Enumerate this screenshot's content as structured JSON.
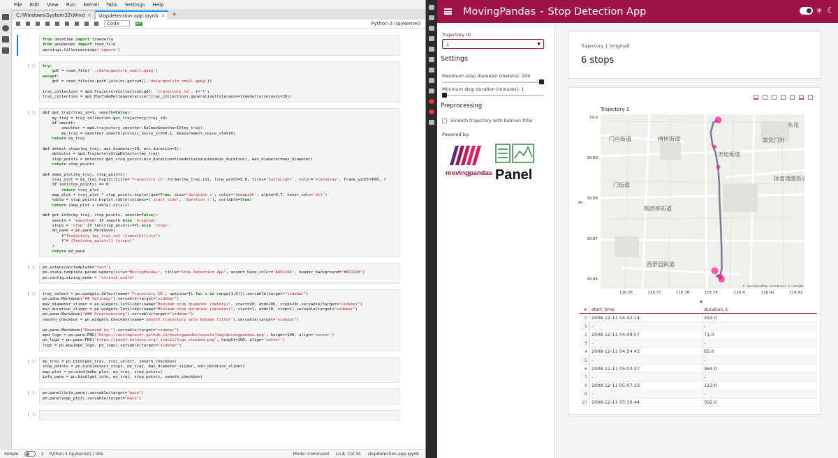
{
  "jupyter": {
    "menu": [
      "File",
      "Edit",
      "View",
      "Run",
      "Kernel",
      "Tabs",
      "Settings",
      "Help"
    ],
    "tabs": [
      {
        "label": "C:\\Windows\\System32\\Wind"
      },
      {
        "label": "stopdetection-app.ipynb"
      }
    ],
    "toolbar": {
      "cell_type": "Code",
      "kernel": "Python 3 (ipykernel)"
    },
    "cells": [
      {
        "prompt": "",
        "lines": [
          "from datetime import timedelta",
          "from geopandas import read_file",
          "warnings.filterwarnings('ignore')"
        ]
      },
      {
        "prompt": "[ ]:",
        "lines": [
          "try:",
          "    gdf = read_file('../data/geolife_small.gpkg')",
          "except:",
          "    gdf = read_file(os.path.join(os.getcwd(),'data/geolife_small.gpkg'))",
          "",
          "traj_collection = mpd.TrajectoryCollection(gdf, 'trajectory_id', t='t')",
          "traj_collection = mpd.MinTimeDeltaGeneralizer(traj_collection).generalize(tolerance=timedelta(seconds=30))"
        ]
      },
      {
        "prompt": "[ ]:",
        "lines": [
          "def get_traj(traj_id=1, smooth=False):",
          "    my_traj = traj_collection.get_trajectory(traj_id)",
          "    if smooth:",
          "        smoother = mpd.trajectory_smoother.KalmanSmootherCV(my_traj)",
          "        my_traj = smoother.smooth(process_noise_std=0.1, measurement_noise_std=10)",
          "    return my_traj",
          "",
          "def detect_stops(my_traj, max_diameter=10, min_duration=1):",
          "    detector = mpd.TrajectoryStopDetector(my_traj)",
          "    stop_points = detector.get_stop_points(min_duration=timedelta(minutes=min_duration), max_diameter=max_diameter)",
          "    return stop_points",
          "",
          "def make_plot(my_traj, stop_points):",
          "    traj_plot = my_traj.hvplot(title='Trajectory {}'.format(my_traj.id), line_width=5.0, tiles='CartoLight', color='slategray', frame_width=600, f",
          "    if len(stop_points) == 0:",
          "        return traj_plot",
          "    map_plot = traj_plot * stop_points.hvplot(geo=True, size='duration_s', color='deeppink', alpha=0.7, hover_cols='all')",
          "    table = stop_points.hvplot.table(columns=['start_time', 'duration_s'], sortable=True)",
          "    return (map_plot + table).cols(1)",
          "",
          "def get_info(my_traj, stop_points, smooth=False):",
          "    smooth = 'smoothed' if smooth else 'original'",
          "    stops = 'stop' if len(stop_points)==1 else 'stops'",
          "    md_pane = pn.pane.Markdown(",
          "        f\"Trajectory {my_traj.id} ({smooth})\\n\\n\"+",
          "        f\"# {len(stop_points)} {stops}\"",
          "    )",
          "    return md_pane"
        ]
      },
      {
        "prompt": "[ ]:",
        "lines": [
          "pn.extension(template=\"fast\")",
          "pn.state.template.param.update(site=\"MovingPandas\", title=\"Stop Detection App\", accent_base_color=\"#A01346\", header_background=\"#A01346\")",
          "pn.config.sizing_mode = \"stretch_width\""
        ]
      },
      {
        "prompt": "[ ]:",
        "lines": [
          "traj_select = pn.widgets.Select(name='Trajectory ID', options=[i for i in range(1,6)]).servable(target=\"sidebar\")",
          "pn.pane.Markdown(\"## Settings\").servable(target=\"sidebar\")",
          "max_diameter_slider = pn.widgets.IntSlider(name=\"Maximum stop diameter (meters)\", start=20, end=200, step=20).servable(target=\"sidebar\")",
          "min_duration_slider = pn.widgets.IntSlider(name=\"Minimum stop duration (minutes)\", start=1, end=10, step=1).servable(target=\"sidebar\")",
          "pn.pane.Markdown(\"### Preprocessing\").servable(target=\"sidebar\")",
          "smooth_checkbox = pn.widgets.Checkbox(name='Smooth trajectory with Kalman filter').servable(target=\"sidebar\")",
          "",
          "pn.pane.Markdown(\"Powered by:\").servable(target=\"sidebar\")",
          "mpd_logo = pn.pane.PNG('https://anitagraser.github.io/movingpandas/assets/img/movingpandas.png', height=100, align='center')",
          "pn_logo = pn.pane.PNG('https://panel.holoviz.org/_static/logo_stacked.png', height=100, align='center')",
          "logo = pn.Row(mpd_logo, pn_logo).servable(target=\"sidebar\")"
        ]
      },
      {
        "prompt": "[ ]:",
        "lines": [
          "my_traj = pn.bind(get_traj, traj_select, smooth_checkbox)",
          "stop_points = pn.bind(detect_stops, my_traj, max_diameter_slider, min_duration_slider)",
          "map_plot = pn.bind(make_plot, my_traj, stop_points)",
          "info_pane = pn.bind(get_info, my_traj, stop_points, smooth_checkbox)"
        ]
      },
      {
        "prompt": "[ ]:",
        "lines": [
          "pn.panel(info_pane).servable(target=\"main\")",
          "pn.panel(map_plot).servable(target=\"main\")"
        ]
      },
      {
        "prompt": "[ ]:",
        "lines": [
          ""
        ]
      }
    ],
    "status": {
      "mode_label": "Simple",
      "cursor_info": "1",
      "kernel_status": "Python 3 (ipykernel) | Idle",
      "mode": "Mode: Command",
      "position": "Ln 8, Col 34",
      "filename": "stopdetection-app.ipynb"
    }
  },
  "app": {
    "site": "MovingPandas",
    "title": "Stop Detection App",
    "header_color": "#a01346",
    "sidebar": {
      "traj_label": "Trajectory ID",
      "traj_value": "1",
      "settings_heading": "Settings",
      "max_diameter_label": "Maximum stop diameter (meters):",
      "max_diameter_value": "200",
      "max_diameter_fraction": 1.0,
      "min_duration_label": "Minimum stop duration (minutes):",
      "min_duration_value": "1",
      "min_duration_fraction": 0.0,
      "preprocessing_heading": "Preprocessing",
      "smooth_label": "Smooth trajectory with Kalman filter",
      "powered_by": "Powered by:",
      "logo_mpd_text": "movingpandas",
      "logo_panel_text": "Panel"
    },
    "info": {
      "subtitle": "Trajectory 1 (original)",
      "stops": "6 stops"
    },
    "plot": {
      "title": "Trajectory 1",
      "xlabel": "x",
      "ylabel": "y",
      "attribution": "© OpenStreetMap contributors, © CartoDB",
      "map_labels": [
        "东花",
        "门内街道",
        "椿树街道",
        "崇文门外",
        "天坛街道",
        "体育馆路街道",
        "门街道",
        "陶然亭街道",
        "西罗园街道"
      ]
    },
    "table": {
      "columns": [
        "#",
        "start_time",
        "duration_s"
      ],
      "rows": [
        [
          "0",
          "2008-12-11 04:42:14",
          "343.0"
        ],
        [
          "1",
          "-",
          "-"
        ],
        [
          "2",
          "2008-12-11 04:49:57",
          "71.0"
        ],
        [
          "3",
          "-",
          "-"
        ],
        [
          "4",
          "2008-12-11 04:54:43",
          "65.0"
        ],
        [
          "5",
          "-",
          "-"
        ],
        [
          "6",
          "2008-12-11 05:00:27",
          "364.0"
        ],
        [
          "7",
          "-",
          "-"
        ],
        [
          "8",
          "2008-12-11 05:07:33",
          "123.0"
        ],
        [
          "9",
          "-",
          "-"
        ],
        [
          "10",
          "2008-12-11 05:10:44",
          "302.0"
        ]
      ]
    }
  },
  "chart_data": {
    "type": "scatter",
    "title": "Trajectory 1",
    "xlabel": "x",
    "ylabel": "y",
    "xticks": [
      "116.36",
      "116.37",
      "116.38",
      "116.39",
      "116.4",
      "116.41",
      "116.42"
    ],
    "yticks": [
      "39.9",
      "39.89",
      "39.88",
      "39.87",
      "39.86"
    ],
    "xlim": [
      116.351,
      116.423
    ],
    "ylim": [
      39.858,
      39.901
    ],
    "track": {
      "x": [
        116.3924,
        116.3908,
        116.3899,
        116.3905,
        116.3916,
        116.3925,
        116.3929,
        116.393,
        116.3933,
        116.3935,
        116.3937,
        116.3938,
        116.3933,
        116.392,
        116.3921,
        116.3935,
        116.3937
      ],
      "y": [
        39.8995,
        39.899,
        39.8965,
        39.8935,
        39.8915,
        39.888,
        39.884,
        39.88,
        39.876,
        39.872,
        39.868,
        39.863,
        39.8613,
        39.8612,
        39.861,
        39.8605,
        39.8603
      ]
    },
    "stops": {
      "x": [
        116.3925,
        116.3912,
        116.3925,
        116.3913,
        116.3933,
        116.3937
      ],
      "y": [
        39.8996,
        39.893,
        39.888,
        39.8624,
        39.8611,
        39.8603
      ],
      "size": [
        343,
        71,
        65,
        364,
        123,
        302
      ]
    }
  }
}
